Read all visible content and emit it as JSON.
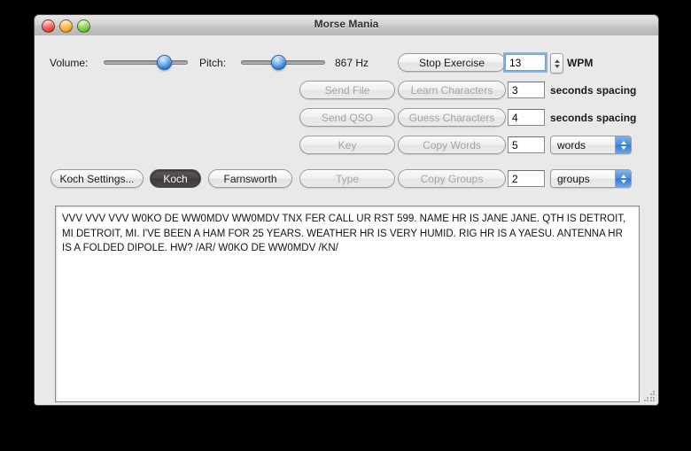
{
  "window": {
    "title": "Morse Mania",
    "traffic_lights": [
      "close-button",
      "minimize-button",
      "zoom-button"
    ]
  },
  "controls": {
    "volume_label": "Volume:",
    "volume_value": 75,
    "pitch_label": "Pitch:",
    "pitch_value": 42,
    "frequency_readout": "867 Hz",
    "stop_exercise_label": "Stop Exercise",
    "wpm_value": "13",
    "wpm_label": "WPM"
  },
  "rows": [
    {
      "left_button": "Send File",
      "right_button": "Learn Characters",
      "field_value": "3",
      "trailing_label": "seconds spacing",
      "popup": null
    },
    {
      "left_button": "Send QSO",
      "right_button": "Guess Characters",
      "field_value": "4",
      "trailing_label": "seconds spacing",
      "popup": null
    },
    {
      "left_button": "Key",
      "right_button": "Copy Words",
      "field_value": "5",
      "trailing_label": null,
      "popup": "words"
    },
    {
      "left_button": "Type",
      "right_button": "Copy Groups",
      "field_value": "2",
      "trailing_label": null,
      "popup": "groups"
    }
  ],
  "mode_bar": {
    "settings_label": "Koch Settings...",
    "koch_label": "Koch",
    "farnsworth_label": "Farnsworth",
    "selected": "Koch"
  },
  "transcript": {
    "text": "VVV VVV VVV W0KO DE WW0MDV WW0MDV TNX FER CALL UR RST 599.  NAME HR IS JANE JANE. QTH IS DETROIT, MI DETROIT, MI. I'VE BEEN A HAM FOR 25 YEARS. WEATHER HR IS VERY HUMID. RIG HR IS A YAESU. ANTENNA HR IS A FOLDED DIPOLE. HW?  /AR/  W0KO DE WW0MDV  /KN/"
  },
  "colors": {
    "desktop": "#000000",
    "window_bg": "#e9e9e9",
    "accent_blue": "#2f79cf",
    "selected_button": "#4a4846"
  }
}
